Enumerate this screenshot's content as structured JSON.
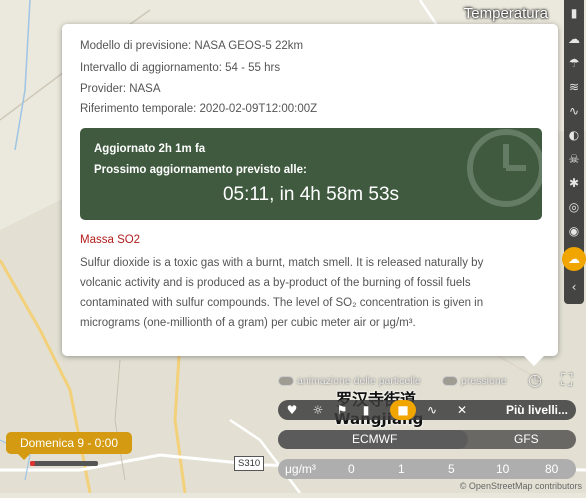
{
  "map": {
    "layer_title": "Temperatura",
    "place_label_cn": "罗汉寺街道",
    "place_label": "Wangjiang",
    "road_shield": "S310",
    "attribution": "© OpenStreetMap contributors"
  },
  "info_popup": {
    "model": "Modello di previsione: NASA GEOS-5 22km",
    "interval": "Intervallo di aggiornamento: 54 - 55 hrs",
    "provider": "Provider: NASA",
    "reference": "Riferimento temporale: 2020-02-09T12:00:00Z",
    "updated": "Aggiornato 2h 1m fa",
    "next_label": "Prossimo aggiornamento previsto alle:",
    "next_time": "05:11, in 4h 58m 53s",
    "layer_name": "Massa SO2",
    "description": "Sulfur dioxide is a toxic gas with a burnt, match smell. It is released naturally by volcanic activity and is produced as a by-product of the burning of fossil fuels contaminated with sulfur compounds. The level of SO₂ concentration is given in micrograms (one-millionth of a gram) per cubic meter air or μg/m³."
  },
  "toggles": {
    "particles": "animazione delle particelle",
    "pressure": "pressione"
  },
  "toolbar": {
    "more_levels": "Più livelli..."
  },
  "models": [
    "ECMWF",
    "GFS"
  ],
  "legend": {
    "unit": "μg/m³",
    "values": [
      "0",
      "1",
      "5",
      "10",
      "80"
    ]
  },
  "timeline": {
    "date_label": "Domenica 9 - 0:00",
    "progress": 0.08
  },
  "colors": {
    "accent": "#f0a500",
    "update_box": "#3f5a3f",
    "layer_name": "#b21d1d"
  }
}
